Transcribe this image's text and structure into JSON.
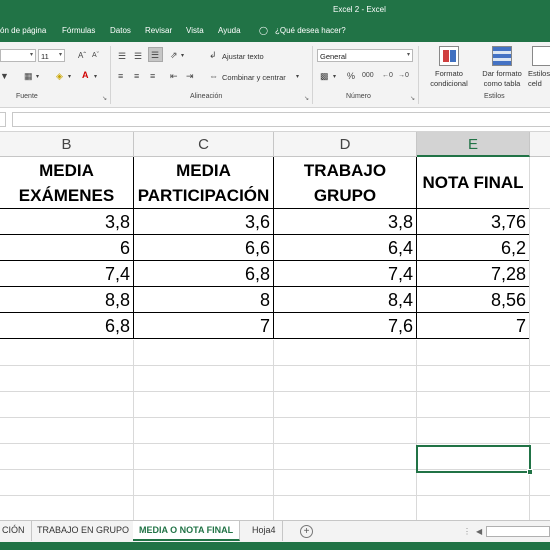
{
  "window": {
    "title": "Excel 2  -  Excel"
  },
  "menu": [
    "ón de página",
    "Fórmulas",
    "Datos",
    "Revisar",
    "Vista",
    "Ayuda",
    "¿Qué desea hacer?"
  ],
  "ribbon": {
    "font_size": "11",
    "wrap_text": "Ajustar texto",
    "merge_center": "Combinar y centrar",
    "number_format": "General",
    "conditional_format": [
      "Formato",
      "condicional"
    ],
    "format_as_table": [
      "Dar formato",
      "como tabla"
    ],
    "cell_styles": [
      "Estilos",
      "celd"
    ],
    "groups": {
      "font": "Fuente",
      "alignment": "Alineación",
      "number": "Número",
      "styles": "Estilos"
    }
  },
  "columns": [
    "B",
    "C",
    "D",
    "E"
  ],
  "selected_column": "E",
  "table": {
    "headers": [
      [
        "MEDIA",
        "EXÁMENES"
      ],
      [
        "MEDIA",
        "PARTICIPACIÓN"
      ],
      [
        "TRABAJO",
        "GRUPO"
      ],
      [
        "NOTA FINAL"
      ]
    ],
    "rows": [
      [
        "3,8",
        "3,6",
        "3,8",
        "3,76"
      ],
      [
        "6",
        "6,6",
        "6,4",
        "6,2"
      ],
      [
        "7,4",
        "6,8",
        "7,4",
        "7,28"
      ],
      [
        "8,8",
        "8",
        "8,4",
        "8,56"
      ],
      [
        "6,8",
        "7",
        "7,6",
        "7"
      ]
    ]
  },
  "sheets": [
    "CIÓN",
    "TRABAJO EN GRUPO",
    "MEDIA O NOTA FINAL",
    "Hoja4"
  ],
  "active_sheet": "MEDIA O NOTA FINAL",
  "colors": {
    "accent": "#217346",
    "border": "#000000",
    "gridline": "#d9d9d9"
  }
}
